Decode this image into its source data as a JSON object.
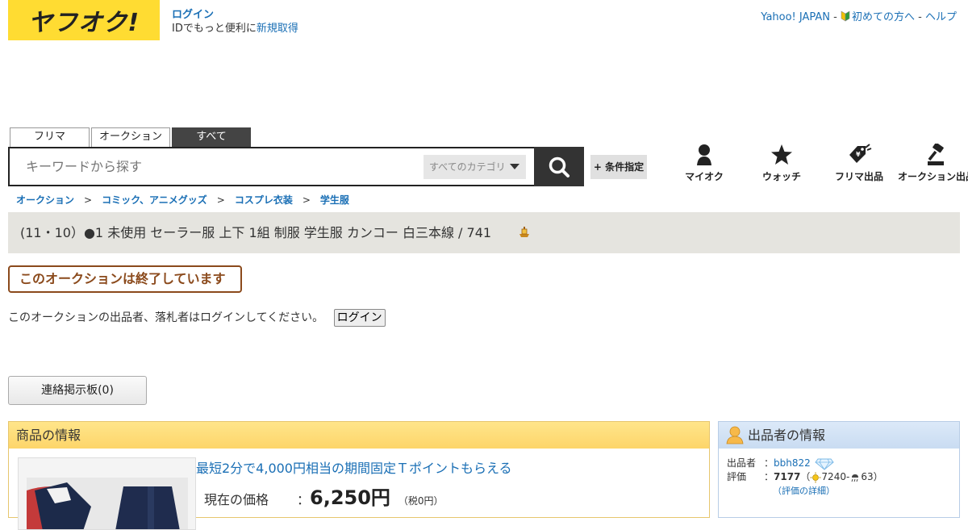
{
  "header": {
    "logo": "ヤフオク!",
    "login": "ログイン",
    "login_sub": "IDでもっと便利に",
    "signup": "新規取得",
    "yahoo_japan": "Yahoo! JAPAN",
    "first_time": "初めての方へ",
    "help": "ヘルプ"
  },
  "search": {
    "tabs": [
      {
        "label": "フリマ"
      },
      {
        "label": "オークション"
      },
      {
        "label": "すべて"
      }
    ],
    "placeholder": "キーワードから探す",
    "category": "すべてのカテゴリ",
    "condition_button": "+ 条件指定"
  },
  "nav": {
    "my_auction": "マイオク",
    "watch": "ウォッチ",
    "flea_listing": "フリマ出品",
    "auction_listing": "オークション出品"
  },
  "breadcrumb": [
    "オークション",
    "コミック、アニメグッズ",
    "コスプレ衣装",
    "学生服"
  ],
  "item": {
    "title": "(11・10）●1 未使用 セーラー服 上下 1組 制服 学生服 カンコー 白三本線 / 741",
    "ended": "このオークションは終了しています",
    "login_message": "このオークションの出品者、落札者はログインしてください。",
    "login_button": "ログイン",
    "board_button": "連絡掲示板(0)",
    "info_header": "商品の情報",
    "promo": "最短2分で4,000円相当の期間固定Ｔポイントもらえる",
    "price_label": "現在の価格",
    "price_colon": "：",
    "price": "6,250円",
    "tax": "（税0円）"
  },
  "seller": {
    "header": "出品者の情報",
    "seller_label": "出品者",
    "seller_colon": "：",
    "seller_name": "bbh822",
    "rating_label": "評価",
    "rating_colon": "：",
    "rating_total": "7177",
    "rating_paren_open": "（",
    "rating_good": "7240",
    "rating_dash": " - ",
    "rating_bad": "63",
    "rating_paren_close": "）",
    "rating_detail": "（評価の詳細）"
  },
  "colors": {
    "brand_yellow": "#ffdc32",
    "link": "#1a6fb5",
    "ended_brown": "#8b4a1c"
  }
}
